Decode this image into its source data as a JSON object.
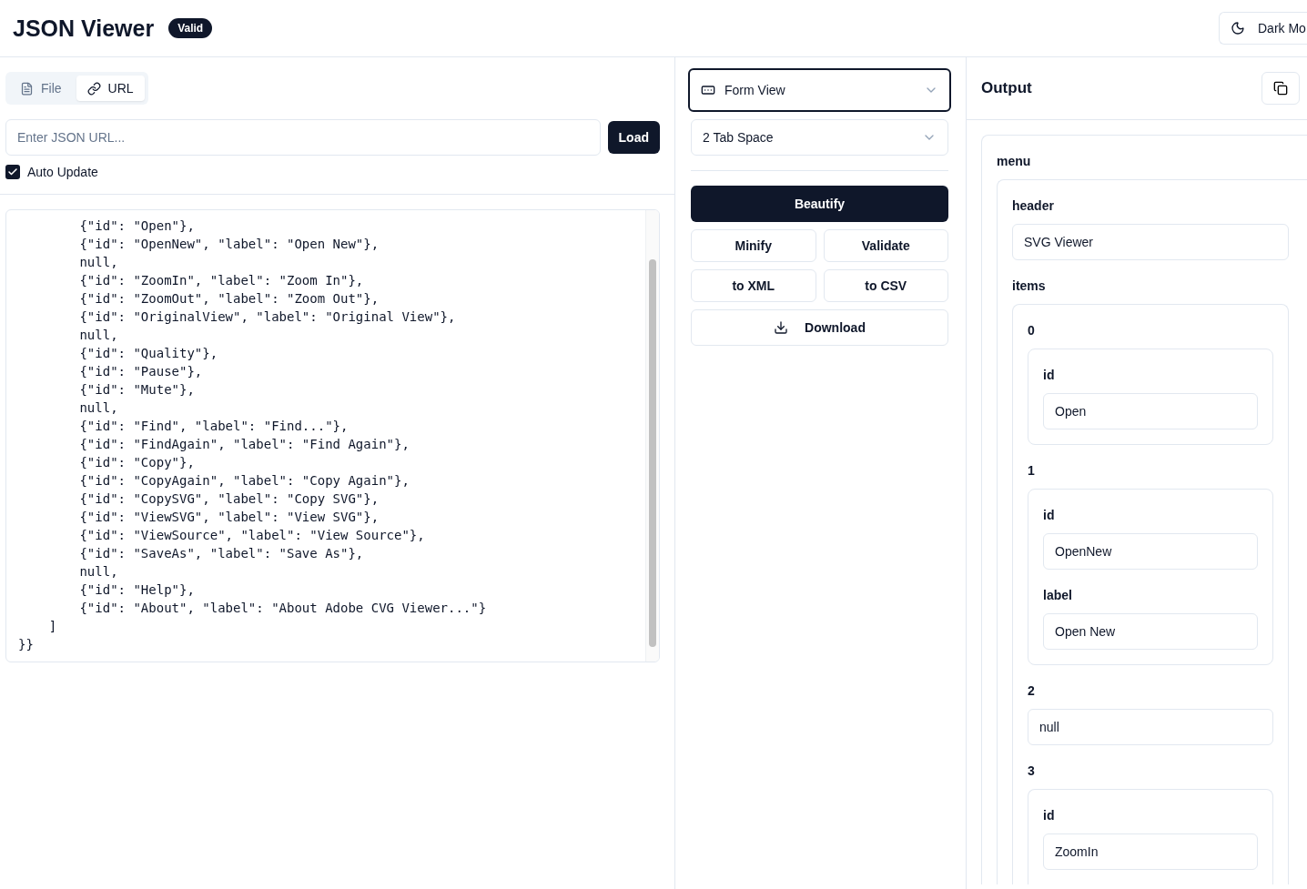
{
  "header": {
    "title": "JSON Viewer",
    "badge": "Valid",
    "theme_button": "Dark Mo"
  },
  "source_tabs": [
    {
      "label": "File",
      "selected": false
    },
    {
      "label": "URL",
      "selected": true
    }
  ],
  "url_field": {
    "placeholder": "Enter JSON URL..."
  },
  "load_button": "Load",
  "auto_update": {
    "label": "Auto Update",
    "checked": true
  },
  "editor_lines": [
    "        {\"id\": \"Open\"},",
    "        {\"id\": \"OpenNew\", \"label\": \"Open New\"},",
    "        null,",
    "        {\"id\": \"ZoomIn\", \"label\": \"Zoom In\"},",
    "        {\"id\": \"ZoomOut\", \"label\": \"Zoom Out\"},",
    "        {\"id\": \"OriginalView\", \"label\": \"Original View\"},",
    "        null,",
    "        {\"id\": \"Quality\"},",
    "        {\"id\": \"Pause\"},",
    "        {\"id\": \"Mute\"},",
    "        null,",
    "        {\"id\": \"Find\", \"label\": \"Find...\"},",
    "        {\"id\": \"FindAgain\", \"label\": \"Find Again\"},",
    "        {\"id\": \"Copy\"},",
    "        {\"id\": \"CopyAgain\", \"label\": \"Copy Again\"},",
    "        {\"id\": \"CopySVG\", \"label\": \"Copy SVG\"},",
    "        {\"id\": \"ViewSVG\", \"label\": \"View SVG\"},",
    "        {\"id\": \"ViewSource\", \"label\": \"View Source\"},",
    "        {\"id\": \"SaveAs\", \"label\": \"Save As\"},",
    "        null,",
    "        {\"id\": \"Help\"},",
    "        {\"id\": \"About\", \"label\": \"About Adobe CVG Viewer...\"}",
    "    ]",
    "}}"
  ],
  "view_select": {
    "value": "Form View",
    "focused": true
  },
  "indent_select": {
    "value": "2 Tab Space",
    "focused": false
  },
  "actions": [
    {
      "label": "Beautify",
      "kind": "primary"
    },
    {
      "label": "Minify",
      "kind": "half"
    },
    {
      "label": "Validate",
      "kind": "half"
    },
    {
      "label": "to XML",
      "kind": "half"
    },
    {
      "label": "to CSV",
      "kind": "half"
    },
    {
      "label": "Download",
      "kind": "download"
    }
  ],
  "output": {
    "title": "Output",
    "root_key": "menu",
    "header_key": "header",
    "header_value": "SVG Viewer",
    "items_key": "items",
    "items": [
      {
        "index": "0",
        "kind": "object",
        "fields": [
          {
            "key": "id",
            "value": "Open"
          }
        ]
      },
      {
        "index": "1",
        "kind": "object",
        "fields": [
          {
            "key": "id",
            "value": "OpenNew"
          },
          {
            "key": "label",
            "value": "Open New"
          }
        ]
      },
      {
        "index": "2",
        "kind": "value",
        "value": "null"
      },
      {
        "index": "3",
        "kind": "object",
        "fields": [
          {
            "key": "id",
            "value": "ZoomIn"
          }
        ]
      }
    ]
  }
}
